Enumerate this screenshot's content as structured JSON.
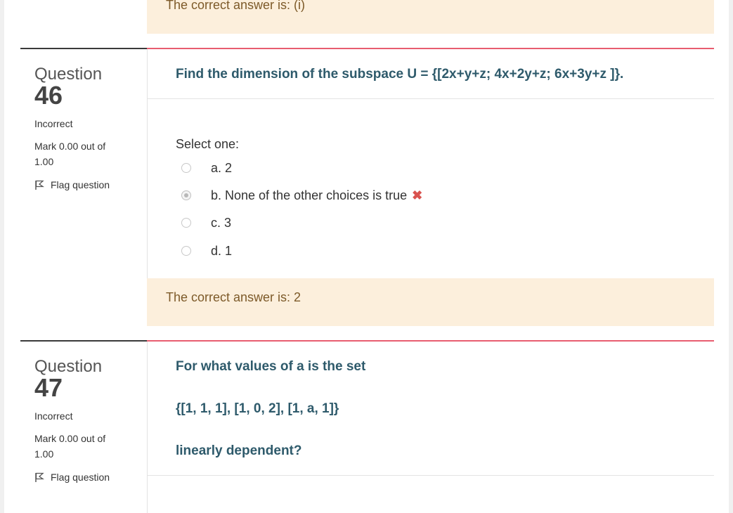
{
  "top_feedback": {
    "text": "The correct answer is: (i)"
  },
  "q46": {
    "label": "Question",
    "number": "46",
    "state": "Incorrect",
    "grade": "Mark 0.00 out of 1.00",
    "flag_label": "Flag question",
    "text": "Find the dimension of the subspace U = {[2x+y+z; 4x+2y+z; 6x+3y+z ]}.",
    "prompt": "Select one:",
    "options": [
      {
        "label": "a. 2",
        "checked": false
      },
      {
        "label": "b. None of the other choices is true",
        "checked": true,
        "mark": "✖"
      },
      {
        "label": "c. 3",
        "checked": false
      },
      {
        "label": "d. 1",
        "checked": false
      }
    ],
    "feedback": "The correct answer is: 2"
  },
  "q47": {
    "label": "Question",
    "number": "47",
    "state": "Incorrect",
    "grade": "Mark 0.00 out of 1.00",
    "flag_label": "Flag question",
    "text_lines": [
      "For what values of a is the set",
      "{[1, 1, 1], [1, 0, 2], [1, a, 1]}",
      "linearly dependent?"
    ]
  },
  "colors": {
    "accent_rule": "#e85d6f",
    "question_text": "#2e5a6b",
    "feedback_bg": "#fcefdc",
    "incorrect_mark": "#d9534f"
  }
}
